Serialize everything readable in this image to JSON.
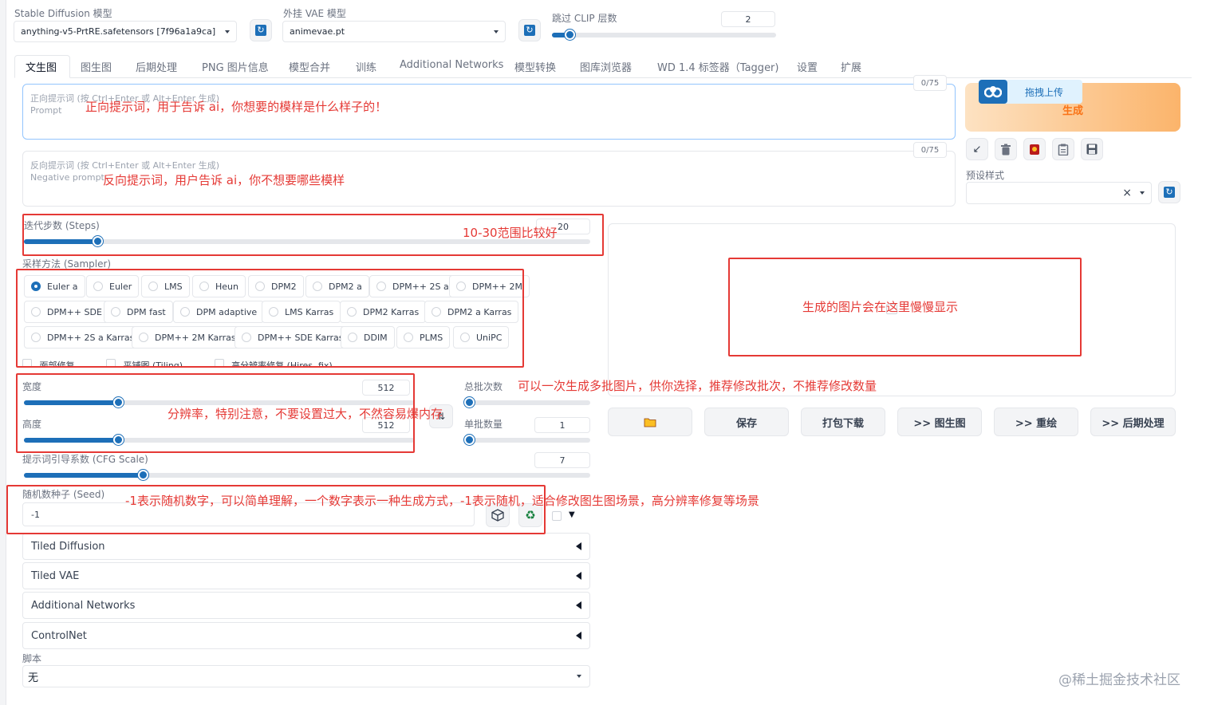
{
  "top": {
    "sd_model_label": "Stable Diffusion 模型",
    "sd_model_value": "anything-v5-PrtRE.safetensors [7f96a1a9ca]",
    "vae_label": "外挂 VAE 模型",
    "vae_value": "animevae.pt",
    "clip_label": "跳过 CLIP 层数",
    "clip_value": "2",
    "clip_fraction": 0.08
  },
  "tabs": [
    "文生图",
    "图生图",
    "后期处理",
    "PNG 图片信息",
    "模型合并",
    "训练",
    "Additional Networks",
    "模型转换",
    "图库浏览器",
    "WD 1.4 标签器（Tagger)",
    "设置",
    "扩展"
  ],
  "prompt": {
    "placeholder_line1": "正向提示词 (按 Ctrl+Enter 或 Alt+Enter 生成)",
    "placeholder_line2": "Prompt",
    "counter": "0/75"
  },
  "negative": {
    "placeholder_line1": "反向提示词 (按 Ctrl+Enter 或 Alt+Enter 生成)",
    "placeholder_line2": "Negative prompt",
    "counter": "0/75"
  },
  "generate": {
    "upload_label": "拖拽上传",
    "generate_label": "生成"
  },
  "styles": {
    "label": "预设样式",
    "clear": "×"
  },
  "steps": {
    "label": "迭代步数 (Steps)",
    "value": "20",
    "fraction": 0.13
  },
  "sampler": {
    "label": "采样方法 (Sampler)",
    "selected": "Euler a",
    "options": [
      "Euler a",
      "Euler",
      "LMS",
      "Heun",
      "DPM2",
      "DPM2 a",
      "DPM++ 2S a",
      "DPM++ 2M",
      "DPM++ SDE",
      "DPM fast",
      "DPM adaptive",
      "LMS Karras",
      "DPM2 Karras",
      "DPM2 a Karras",
      "DPM++ 2S a Karras",
      "DPM++ 2M Karras",
      "DPM++ SDE Karras",
      "DDIM",
      "PLMS",
      "UniPC"
    ]
  },
  "checkboxes": [
    "面部修复",
    "平铺图 (Tiling)",
    "高分辨率修复 (Hires. fix)"
  ],
  "width": {
    "label": "宽度",
    "value": "512",
    "fraction": 0.24
  },
  "height": {
    "label": "高度",
    "value": "512",
    "fraction": 0.24
  },
  "batch_count": {
    "label": "总批次数",
    "value": "1",
    "fraction": 0.0
  },
  "batch_size": {
    "label": "单批数量",
    "value": "1",
    "fraction": 0.0
  },
  "cfg": {
    "label": "提示词引导系数 (CFG Scale)",
    "value": "7",
    "fraction": 0.21
  },
  "seed": {
    "label": "随机数种子 (Seed)",
    "value": "-1"
  },
  "accordions": [
    "Tiled Diffusion",
    "Tiled VAE",
    "Additional Networks",
    "ControlNet"
  ],
  "script": {
    "label": "脚本",
    "value": "无"
  },
  "actions": [
    "保存",
    "打包下载",
    ">> 图生图",
    ">> 重绘",
    ">> 后期处理"
  ],
  "annotations": {
    "prompt_note": "正向提示词，用于告诉 ai，你想要的模样是什么样子的！",
    "negative_note": "反向提示词，用户告诉 ai，你不想要哪些模样",
    "steps_note": "10-30范围比较好",
    "output_note": "生成的图片会在这里慢慢显示",
    "batch_note": "可以一次生成多批图片，供你选择，推荐修改批次，不推荐修改数量",
    "size_note": "分辨率，特别注意，不要设置过大，不然容易爆内存",
    "seed_note": "-1表示随机数字，可以简单理解，一个数字表示一种生成方式，-1表示随机，适合修改图生图场景，高分辨率修复等场景"
  },
  "watermark": "@稀土掘金技术社区",
  "colors": {
    "accent": "#1d6fb8",
    "annotation": "#e53935",
    "generate_bg": "#fbb46b",
    "generate_text": "#f97316"
  }
}
